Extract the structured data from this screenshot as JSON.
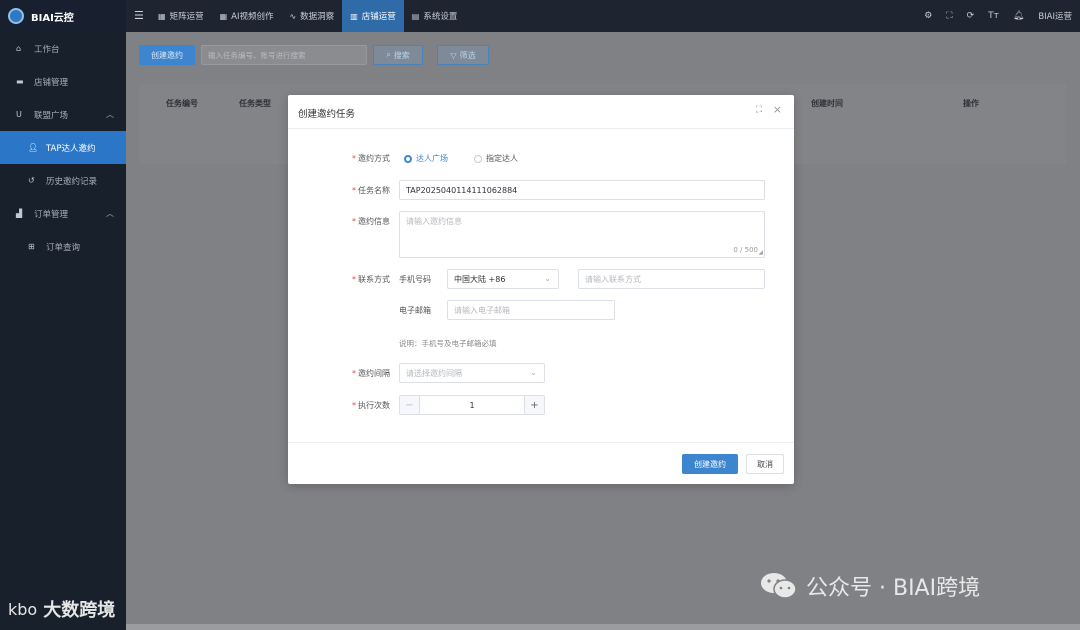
{
  "app": {
    "brand": "BIAI云控"
  },
  "topnav": {
    "menu_icon": "menu-icon",
    "items": [
      {
        "label": "矩阵运营",
        "icon": "video-matrix-icon"
      },
      {
        "label": "AI视频创作",
        "icon": "grid-icon"
      },
      {
        "label": "数据洞察",
        "icon": "chart-icon"
      },
      {
        "label": "店铺运营",
        "icon": "store-icon",
        "active": true
      },
      {
        "label": "系统设置",
        "icon": "document-icon"
      }
    ],
    "right_icons": [
      "settings-icon",
      "fullscreen-icon",
      "refresh-icon",
      "font-size-icon",
      "bell-icon"
    ],
    "user": "BIAI运营"
  },
  "sidebar": {
    "items": [
      {
        "label": "工作台",
        "icon": "home-icon"
      },
      {
        "label": "店铺管理",
        "icon": "store-icon"
      },
      {
        "label": "联盟广场",
        "icon": "union-icon",
        "expanded": true
      },
      {
        "label": "TAP达人邀约",
        "icon": "user-icon",
        "active": true
      },
      {
        "label": "历史邀约记录",
        "icon": "history-icon"
      },
      {
        "label": "订单管理",
        "icon": "order-icon",
        "expanded": true
      },
      {
        "label": "订单查询",
        "icon": "grid-icon"
      }
    ]
  },
  "toolbar": {
    "create_label": "创建邀约",
    "search_placeholder": "输入任务编号、账号进行搜索",
    "search_label": "搜索",
    "filter_label": "筛选"
  },
  "table": {
    "headers": [
      "任务编号",
      "任务类型",
      "创建时间",
      "操作"
    ]
  },
  "dialog": {
    "title": "创建邀约任务",
    "invite_method": {
      "label": "邀约方式",
      "options": [
        "达人广场",
        "指定达人"
      ],
      "selected": "达人广场"
    },
    "task_name": {
      "label": "任务名称",
      "value": "TAP20250401141110628​84"
    },
    "invite_info": {
      "label": "邀约信息",
      "placeholder": "请输入邀约信息",
      "counter": "0 / 500"
    },
    "contact": {
      "label": "联系方式",
      "phone_label": "手机号码",
      "region_value": "中国大陆 +86",
      "phone_placeholder": "请输入联系方式",
      "email_label": "电子邮箱",
      "email_placeholder": "请输入电子邮箱",
      "note": "说明：手机号及电子邮箱必填"
    },
    "interval": {
      "label": "邀约间隔",
      "placeholder": "请选择邀约间隔"
    },
    "count": {
      "label": "执行次数",
      "value": "1"
    },
    "submit_label": "创建邀约",
    "cancel_label": "取消"
  },
  "watermarks": {
    "right": "公众号 · BIAI跨境",
    "left": "大数跨境",
    "left_logo": "kbo"
  }
}
